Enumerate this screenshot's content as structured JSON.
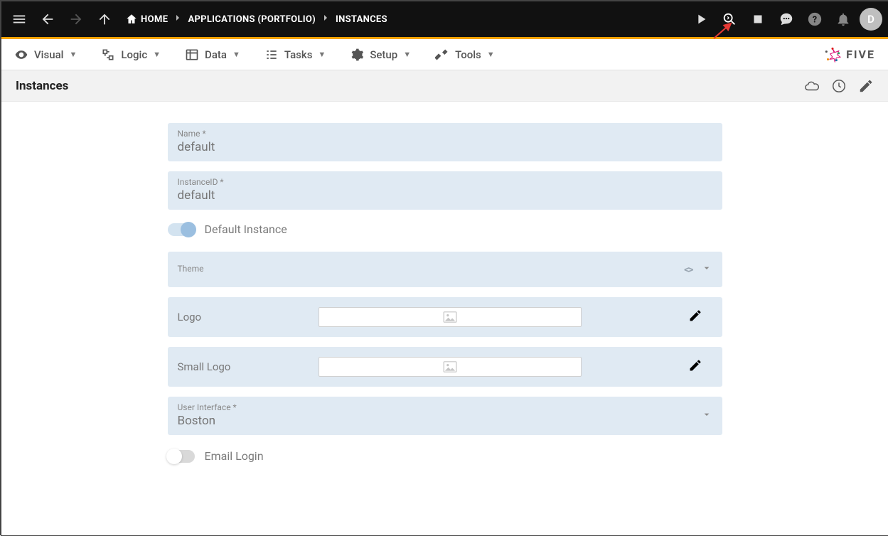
{
  "topbar": {
    "home_label": "HOME",
    "crumb_app": "APPLICATIONS (PORTFOLIO)",
    "crumb_instances": "INSTANCES",
    "avatar_initial": "D"
  },
  "toolbar": {
    "visual": "Visual",
    "logic": "Logic",
    "data": "Data",
    "tasks": "Tasks",
    "setup": "Setup",
    "tools": "Tools",
    "brand": "FIVE"
  },
  "page": {
    "title": "Instances"
  },
  "form": {
    "name_label": "Name *",
    "name_value": "default",
    "instanceid_label": "InstanceID *",
    "instanceid_value": "default",
    "default_instance_label": "Default Instance",
    "theme_label": "Theme",
    "logo_label": "Logo",
    "small_logo_label": "Small Logo",
    "ui_label": "User Interface *",
    "ui_value": "Boston",
    "email_login_label": "Email Login"
  }
}
